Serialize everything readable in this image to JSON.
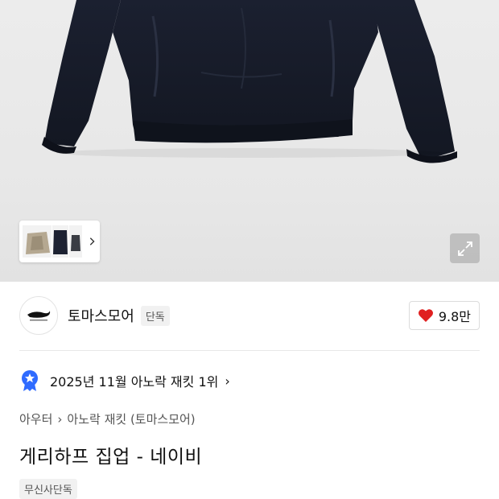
{
  "hero": {
    "thumbnail_more_icon": "chevron-right-icon",
    "expand_icon": "expand-icon"
  },
  "brand": {
    "name": "토마스모어",
    "badge": "단독",
    "like_count": "9.8만",
    "like_icon": "heart-icon",
    "like_color": "#e02020"
  },
  "ranking": {
    "icon": "ranking-badge-icon",
    "icon_color": "#2f6bff",
    "text": "2025년 11월 아노락 재킷 1위",
    "chevron": "›"
  },
  "breadcrumb": {
    "items": [
      "아우터",
      "아노락 재킷 (토마스모어)"
    ],
    "separator": "›"
  },
  "product": {
    "title": "게리하프 집업 - 네이비",
    "tag": "무신사단독"
  }
}
